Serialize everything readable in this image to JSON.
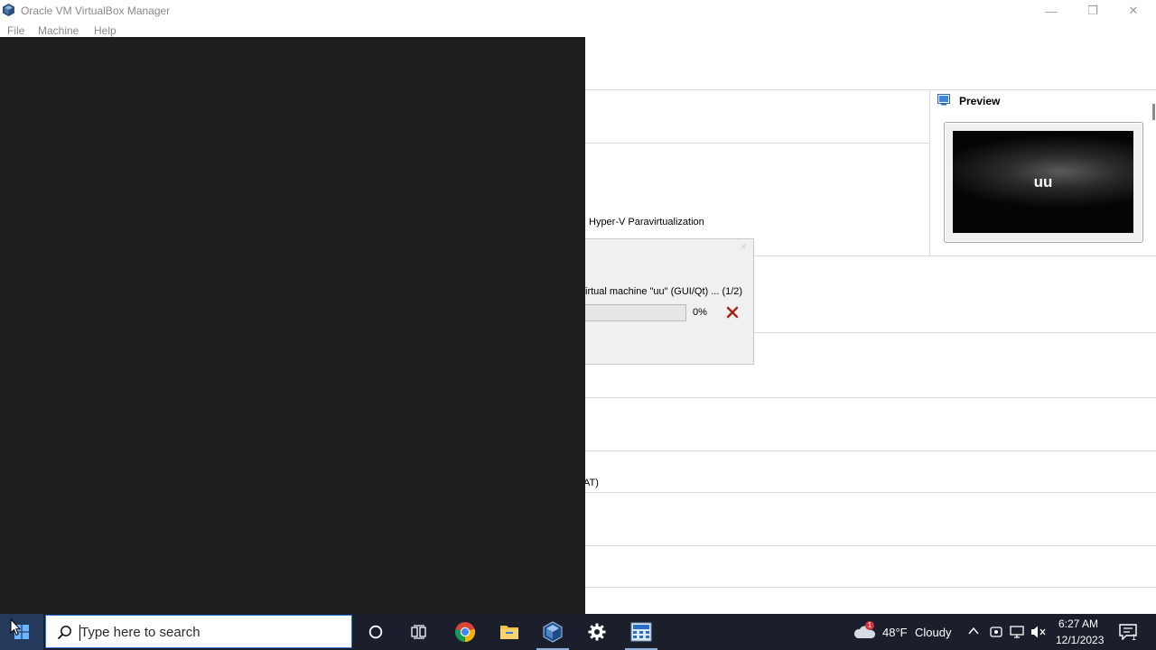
{
  "window": {
    "title": "Oracle VM VirtualBox Manager",
    "minimize_label": "—",
    "restore_label": "❐",
    "close_label": "✕"
  },
  "menu": {
    "items": [
      "File",
      "Machine",
      "Help"
    ]
  },
  "details": {
    "paravirtualization_text": "Hyper-V Paravirtualization",
    "partial_text": "AT)"
  },
  "preview": {
    "title": "Preview",
    "vm_name": "uu"
  },
  "progress_dialog": {
    "message": "irtual machine \"uu\" (GUI/Qt) ... (1/2)",
    "percent": "0%",
    "progress_value": 0,
    "close_label": "✕"
  },
  "taskbar": {
    "search_placeholder": "Type here to search",
    "weather_temp": "48°F",
    "weather_condition": "Cloudy",
    "weather_badge": "1",
    "time": "6:27 AM",
    "date": "12/1/2023",
    "notification_count": "1",
    "apps": [
      "cortana-icon",
      "task-view-icon",
      "chrome-icon",
      "file-explorer-icon",
      "virtualbox-icon",
      "settings-icon",
      "calculator-app-icon"
    ]
  },
  "colors": {
    "dark_window": "#1f1f1f",
    "taskbar": "#1a1f2b",
    "accent": "#2c7ad6"
  }
}
